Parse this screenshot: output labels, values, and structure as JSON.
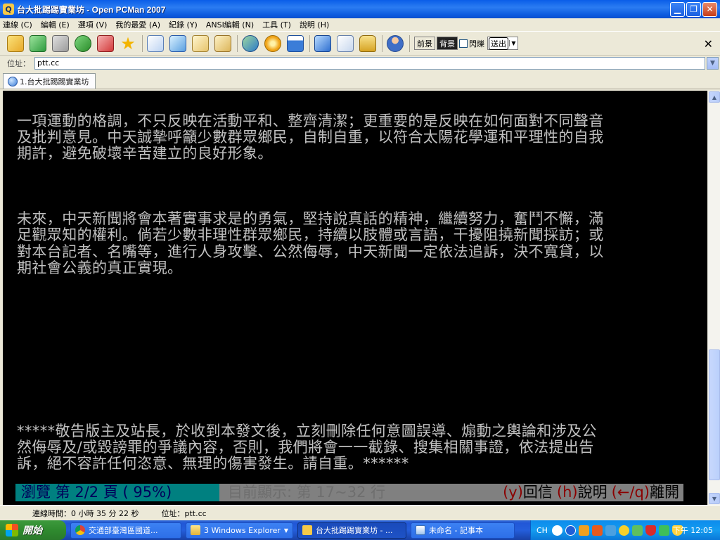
{
  "window": {
    "title": "台大批踢踢實業坊 - Open PCMan 2007",
    "icon_symbol": "Q"
  },
  "menu": [
    "連線 (C)",
    "編輯 (E)",
    "選項 (V)",
    "我的最愛 (A)",
    "紀錄 (Y)",
    "ANSI編輯 (N)",
    "工具 (T)",
    "說明 (H)"
  ],
  "toolbar": {
    "foreground_label": "前景",
    "background_label": "背景",
    "blink_label": "閃爍",
    "send_label": "送出",
    "close_symbol": "✕"
  },
  "address": {
    "label": "位址：",
    "value": "ptt.cc"
  },
  "tabs": [
    {
      "label": "1.台大批踢踢實業坊"
    }
  ],
  "terminal": {
    "lines": [
      "一項運動的格調，不只反映在活動平和、整齊清潔；更重要的是反映在如何面對不同聲音",
      "及批判意見。中天誠摯呼籲少數群眾鄉民，自制自重，以符合太陽花學運和平理性的自我",
      "期許，避免破壞辛苦建立的良好形象。",
      "",
      "",
      "",
      "未來，中天新聞將會本著實事求是的勇氣，堅持說真話的精神，繼續努力，奮鬥不懈，滿",
      "足觀眾知的權利。倘若少數非理性群眾鄉民，持續以肢體或言語，干擾阻撓新聞採訪；或",
      "對本台記者、名嘴等，進行人身攻擊、公然侮辱，中天新聞一定依法追訴，決不寬貸，以",
      "期社會公義的真正實現。",
      "",
      "",
      "",
      "",
      "",
      "",
      "",
      "",
      "",
      "*****敬告版主及站長，於收到本發文後，立刻刪除任何意圖誤導、煽動之輿論和涉及公",
      "然侮辱及/或毀謗罪的爭議內容，否則，我們將會一一截錄、搜集相關事證，依法提出告",
      "訴，絕不容許任何恣意、無理的傷害發生。請自重。******"
    ],
    "status": {
      "browse": "瀏覽 第 2/2 頁 ( 95%)",
      "range": "目前顯示: 第 17~32 行",
      "reply_key": "(y)",
      "reply_word": "回信",
      "help_key": "(h)",
      "help_word": "說明",
      "leave_key": "(←/q)",
      "leave_word": "離開"
    },
    "scroll_position_fraction": 0.95
  },
  "statusbar": {
    "connection": "連線時間：0 小時 35 分 22 秒",
    "address": "位址：ptt.cc"
  },
  "taskbar": {
    "start_label": "開始",
    "tasks": [
      {
        "label": "交通部臺灣區國道...",
        "icon": "chrome-icon"
      },
      {
        "label": "3 Windows Explorer",
        "icon": "folder-icon"
      },
      {
        "label": "台大批踢踢實業坊 - ...",
        "icon": "pcman-icon"
      },
      {
        "label": "未命名 - 記事本",
        "icon": "notepad-icon"
      }
    ],
    "tray": {
      "lang": "CH",
      "clock": "下午 12:05"
    }
  }
}
